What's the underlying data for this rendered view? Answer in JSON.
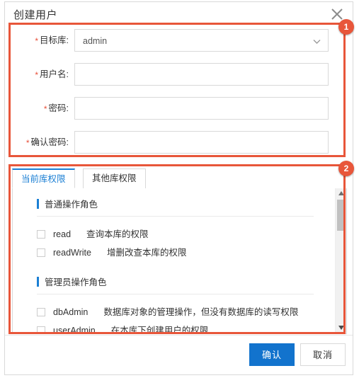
{
  "dialog": {
    "title": "创建用户",
    "close_icon": "close-icon"
  },
  "form": {
    "target_db": {
      "label": "目标库:",
      "required_mark": "*",
      "value": "admin",
      "icon": "chevron-down-icon"
    },
    "username": {
      "label": "用户名:",
      "required_mark": "*",
      "value": "",
      "placeholder": ""
    },
    "password": {
      "label": "密码:",
      "required_mark": "*",
      "value": "",
      "placeholder": ""
    },
    "confirm_password": {
      "label": "确认密码:",
      "required_mark": "*",
      "value": "",
      "placeholder": ""
    }
  },
  "tabs": [
    {
      "label": "当前库权限",
      "active": true
    },
    {
      "label": "其他库权限",
      "active": false
    }
  ],
  "permissions": {
    "groups": [
      {
        "title": "普通操作角色",
        "rows": [
          {
            "name": "read",
            "desc": "查询本库的权限",
            "checked": false
          },
          {
            "name": "readWrite",
            "desc": "增删改查本库的权限",
            "checked": false
          }
        ]
      },
      {
        "title": "管理员操作角色",
        "rows": [
          {
            "name": "dbAdmin",
            "desc": "数据库对象的管理操作，但没有数据库的读写权限",
            "checked": false
          },
          {
            "name": "userAdmin",
            "desc": "在本库下创建用户的权限",
            "checked": false
          }
        ]
      }
    ]
  },
  "scrollbar": {
    "up_icon": "caret-up-icon",
    "down_icon": "caret-down-icon"
  },
  "footer": {
    "confirm_label": "确认",
    "cancel_label": "取消"
  },
  "annotations": [
    {
      "number": "1"
    },
    {
      "number": "2"
    }
  ],
  "colors": {
    "annotation": "#e8563a",
    "primary": "#1273cd",
    "tab_active": "#1b7fd4",
    "required": "#e8503a"
  }
}
